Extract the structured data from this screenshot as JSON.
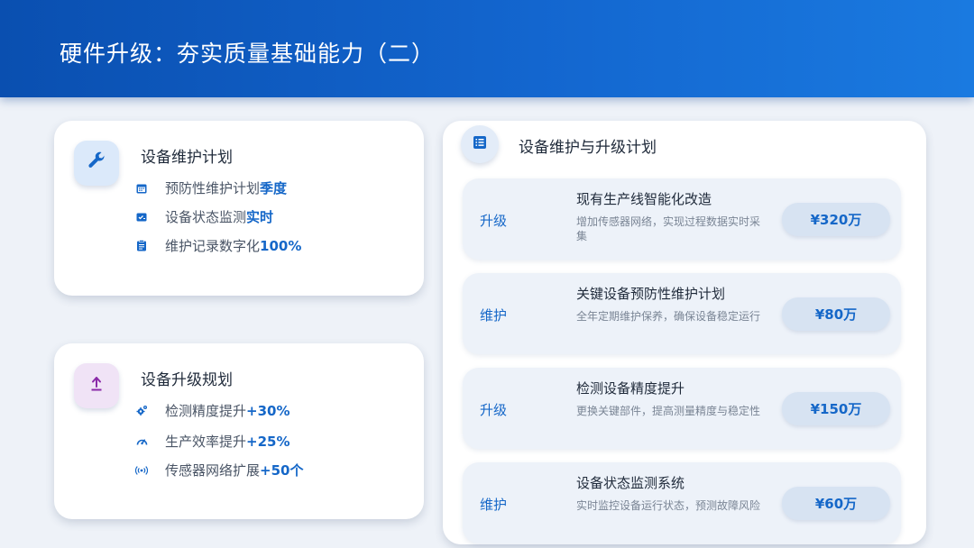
{
  "header": {
    "title": "硬件升级：夯实质量基础能力（二）"
  },
  "maintenance_card": {
    "title": "设备维护计划",
    "icon": "wrench-icon",
    "items": [
      {
        "icon": "calendar-icon",
        "text": "预防性维护计划",
        "highlight": "季度"
      },
      {
        "icon": "monitor-check-icon",
        "text": "设备状态监测",
        "highlight": "实时"
      },
      {
        "icon": "clipboard-icon",
        "text": "维护记录数字化",
        "highlight": "100%"
      }
    ]
  },
  "upgrade_card": {
    "title": "设备升级规划",
    "icon": "upload-icon",
    "items": [
      {
        "icon": "gears-icon",
        "text": "检测精度提升",
        "highlight": "+30%"
      },
      {
        "icon": "gauge-icon",
        "text": "生产效率提升",
        "highlight": "+25%"
      },
      {
        "icon": "broadcast-icon",
        "text": "传感器网络扩展",
        "highlight": "+50个"
      }
    ]
  },
  "plan_card": {
    "title": "设备维护与升级计划",
    "icon": "list-icon",
    "rows": [
      {
        "tag": "升级",
        "title": "现有生产线智能化改造",
        "desc": "增加传感器网络，实现过程数据实时采集",
        "price": "¥320万"
      },
      {
        "tag": "维护",
        "title": "关键设备预防性维护计划",
        "desc": "全年定期维护保养，确保设备稳定运行",
        "price": "¥80万"
      },
      {
        "tag": "升级",
        "title": "检测设备精度提升",
        "desc": "更换关键部件，提高测量精度与稳定性",
        "price": "¥150万"
      },
      {
        "tag": "维护",
        "title": "设备状态监测系统",
        "desc": "实时监控设备运行状态，预测故障风险",
        "price": "¥60万"
      }
    ]
  },
  "colors": {
    "accent": "#1567c8",
    "header_start": "#0a4fb0",
    "header_end": "#1a7ae0",
    "purple": "#8a2aa8"
  }
}
